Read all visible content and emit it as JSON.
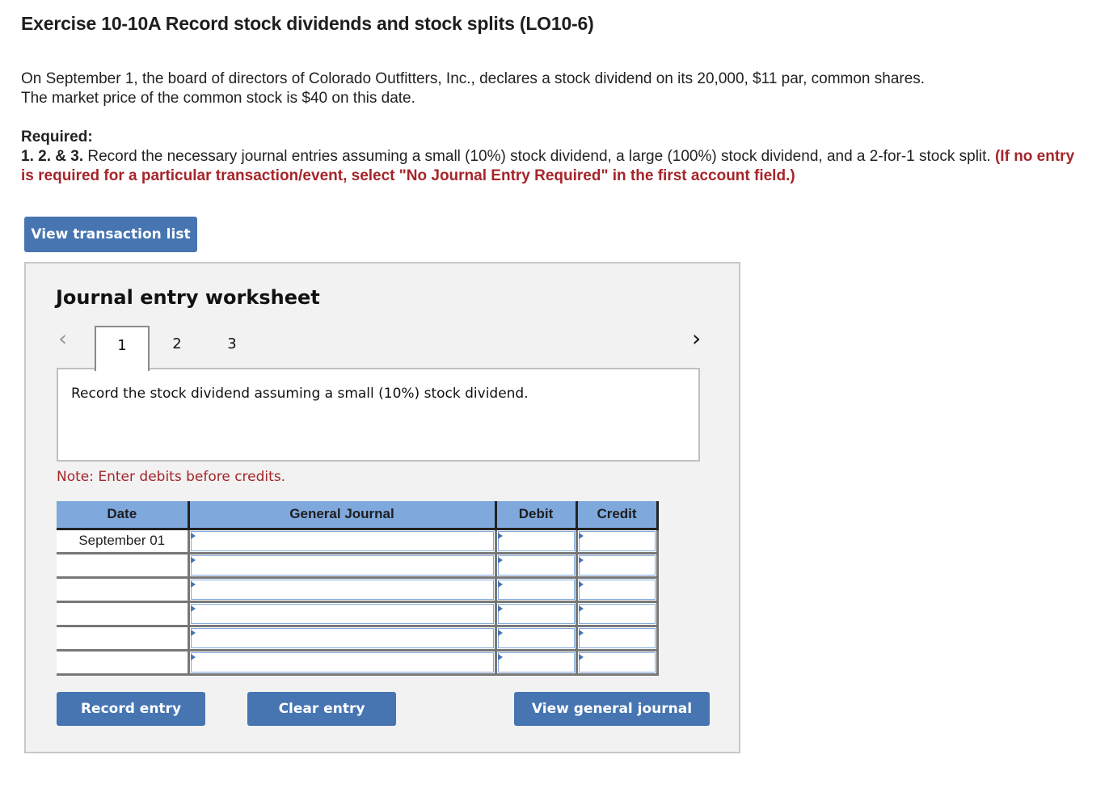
{
  "header": {
    "title": "Exercise 10-10A Record stock dividends and stock splits (LO10-6)"
  },
  "intro": {
    "line1": "On September 1, the board of directors of Colorado Outfitters, Inc., declares a stock dividend on its 20,000, $11 par, common shares.",
    "line2": "The market price of the common stock is $40 on this date."
  },
  "required": {
    "label": "Required:",
    "numbers": "1. 2. & 3.",
    "text": " Record the necessary journal entries assuming a small (10%) stock dividend, a large (100%) stock dividend, and a 2-for-1 stock split. ",
    "instruction": "(If no entry is required for a particular transaction/event, select \"No Journal Entry Required\" in the first account field.)"
  },
  "buttons": {
    "view_transaction_list": "View transaction list",
    "record_entry": "Record entry",
    "clear_entry": "Clear entry",
    "view_general_journal": "View general journal"
  },
  "worksheet": {
    "title": "Journal entry worksheet",
    "nav_prev_icon": "‹",
    "nav_next_icon": "›",
    "tabs": [
      {
        "label": "1",
        "active": true
      },
      {
        "label": "2",
        "active": false
      },
      {
        "label": "3",
        "active": false
      }
    ],
    "description": "Record the stock dividend assuming a small (10%) stock dividend.",
    "note": "Note: Enter debits before credits."
  },
  "journal": {
    "columns": {
      "date": "Date",
      "general_journal": "General Journal",
      "debit": "Debit",
      "credit": "Credit"
    },
    "rows": [
      {
        "date": "September 01",
        "account": "",
        "debit": "",
        "credit": ""
      },
      {
        "date": "",
        "account": "",
        "debit": "",
        "credit": ""
      },
      {
        "date": "",
        "account": "",
        "debit": "",
        "credit": ""
      },
      {
        "date": "",
        "account": "",
        "debit": "",
        "credit": ""
      },
      {
        "date": "",
        "account": "",
        "debit": "",
        "credit": ""
      },
      {
        "date": "",
        "account": "",
        "debit": "",
        "credit": ""
      }
    ]
  },
  "colors": {
    "button_blue": "#4775b2",
    "header_blue": "#7fa8dd",
    "accent_red": "#a5252a"
  }
}
